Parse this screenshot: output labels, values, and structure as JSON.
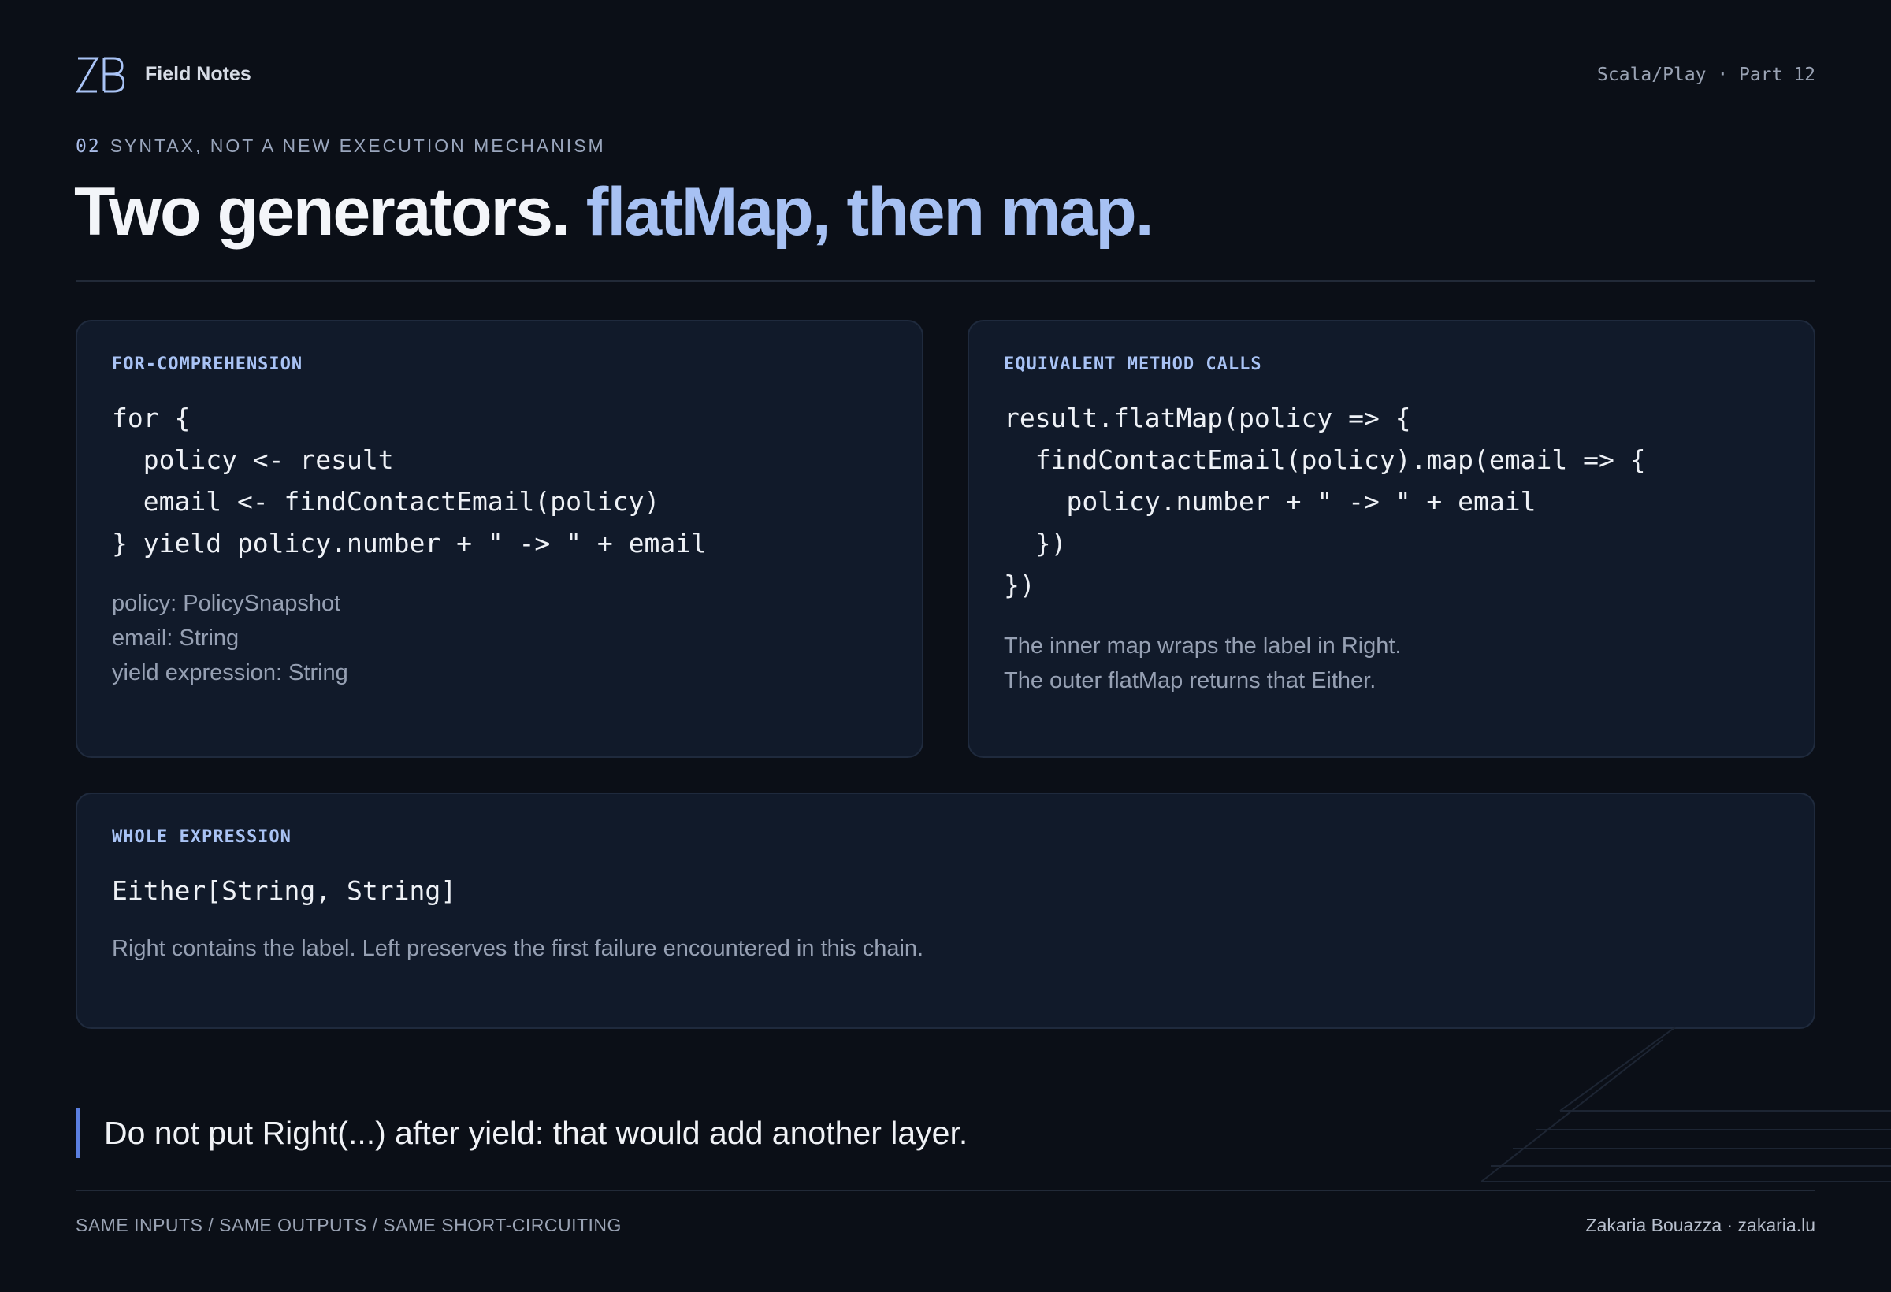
{
  "header": {
    "logo": "ZB",
    "brand": "Field Notes",
    "series": "Scala/Play · Part 12"
  },
  "section": {
    "number": "02",
    "kicker": "SYNTAX, NOT A NEW EXECUTION MECHANISM"
  },
  "title": {
    "main": "Two generators.",
    "accent": "flatMap, then map."
  },
  "cards": {
    "for_comprehension": {
      "label": "FOR-COMPREHENSION",
      "code": "for {\n  policy <- result\n  email <- findContactEmail(policy)\n} yield policy.number + \" -> \" + email",
      "notes": [
        "policy: PolicySnapshot",
        "email: String",
        "yield expression: String"
      ]
    },
    "method_calls": {
      "label": "EQUIVALENT METHOD CALLS",
      "code": "result.flatMap(policy => {\n  findContactEmail(policy).map(email => {\n    policy.number + \" -> \" + email\n  })\n})",
      "notes": [
        "The inner map wraps the label in Right.",
        "The outer flatMap returns that Either."
      ]
    },
    "whole_expression": {
      "label": "WHOLE EXPRESSION",
      "code": "Either[String, String]",
      "note": "Right contains the label. Left preserves the first failure encountered in this chain."
    }
  },
  "callout": "Do not put Right(...) after yield: that would add another layer.",
  "footer": {
    "left": "SAME INPUTS / SAME OUTPUTS / SAME SHORT-CIRCUITING",
    "right": "Zakaria Bouazza · zakaria.lu"
  },
  "colors": {
    "background": "#0b0f17",
    "card": "#111a2a",
    "accent": "#a7c1f3",
    "callout_bar": "#5b7fe0"
  }
}
